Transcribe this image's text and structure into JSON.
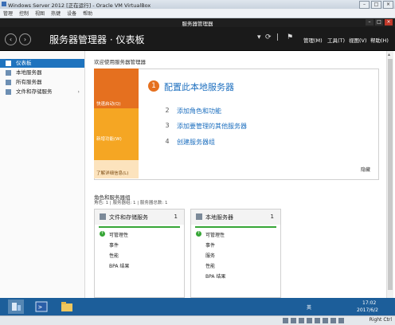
{
  "vbox": {
    "title": "Windows Server 2012 [正在运行] - Oracle VM VirtualBox",
    "menu": [
      "管理",
      "控制",
      "视图",
      "热键",
      "设备",
      "帮助"
    ],
    "host_key": "Right Ctrl"
  },
  "caption": {
    "title": "服务器管理器"
  },
  "header": {
    "title": "服务器管理器 · 仪表板",
    "menu": {
      "manage": "管理(M)",
      "tools": "工具(T)",
      "view": "视图(V)",
      "help": "帮助(H)"
    }
  },
  "sidebar": {
    "items": [
      {
        "label": "仪表板",
        "active": true
      },
      {
        "label": "本地服务器"
      },
      {
        "label": "所有服务器"
      },
      {
        "label": "文件和存储服务",
        "has_submenu": true
      }
    ]
  },
  "welcome": {
    "heading": "欢迎使用服务器管理器",
    "tiles": {
      "quick_start": "快速启动(Q)",
      "whats_new": "新增功能(W)",
      "learn_more": "了解详细信息(L)"
    },
    "steps": [
      {
        "num": "1",
        "label": "配置此本地服务器"
      },
      {
        "num": "2",
        "label": "添加角色和功能"
      },
      {
        "num": "3",
        "label": "添加要管理的其他服务器"
      },
      {
        "num": "4",
        "label": "创建服务器组"
      }
    ],
    "hide": "隐藏"
  },
  "roles": {
    "title": "角色和服务器组",
    "subtitle": "角色: 1 | 服务器组: 1 | 服务器总数: 1",
    "cards": [
      {
        "name": "文件和存储服务",
        "count": "1",
        "rows": [
          "可管理性",
          "事件",
          "性能",
          "BPA 结果"
        ]
      },
      {
        "name": "本地服务器",
        "count": "1",
        "rows": [
          "可管理性",
          "事件",
          "服务",
          "性能",
          "BPA 结果"
        ]
      }
    ]
  },
  "taskbar": {
    "ime": "英",
    "time": "17:02",
    "date": "2017/6/2"
  },
  "colors": {
    "accent": "#1e73be",
    "orange": "#e5701f",
    "amber": "#f5a623",
    "green": "#36a636",
    "taskbar": "#1c5e9a"
  }
}
